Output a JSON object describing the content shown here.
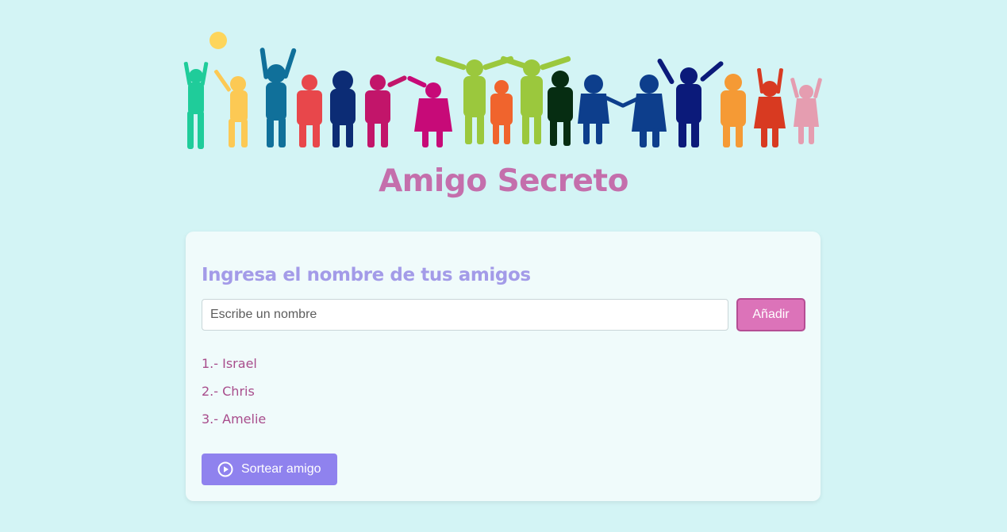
{
  "header": {
    "title": "Amigo Secreto",
    "banner_icon": "children-silhouettes-banner"
  },
  "form": {
    "heading": "Ingresa el nombre de tus amigos",
    "input_placeholder": "Escribe un nombre",
    "input_value": "",
    "add_button_label": "Añadir"
  },
  "friends": [
    "1.- Israel",
    "2.- Chris",
    "3.- Amelie"
  ],
  "draw": {
    "button_label": "Sortear amigo",
    "icon": "play-circle-icon"
  },
  "colors": {
    "background": "#d3f4f5",
    "title": "#c46fac",
    "heading": "#a39be8",
    "add_button": "#dc73b9",
    "draw_button": "#8f82ee",
    "friend_text": "#a84d8c"
  }
}
